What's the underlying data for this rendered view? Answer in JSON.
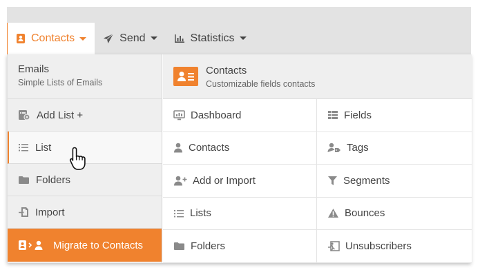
{
  "nav": {
    "items": [
      {
        "label": "Contacts",
        "icon": "contacts-book-icon",
        "active": true
      },
      {
        "label": "Send",
        "icon": "paper-plane-icon"
      },
      {
        "label": "Statistics",
        "icon": "bar-chart-icon"
      }
    ]
  },
  "left": {
    "title": "Emails",
    "subtitle": "Simple Lists of Emails",
    "items": [
      {
        "label": "Add List +",
        "icon": "add-list-icon"
      },
      {
        "label": "List",
        "icon": "list-icon"
      },
      {
        "label": "Folders",
        "icon": "folder-icon"
      },
      {
        "label": "Import",
        "icon": "import-icon"
      },
      {
        "label": "Migrate to Contacts",
        "icon": "migrate-icon"
      }
    ]
  },
  "right": {
    "title": "Contacts",
    "subtitle": "Customizable fields contacts",
    "items": [
      {
        "label": "Dashboard",
        "icon": "dashboard-icon"
      },
      {
        "label": "Fields",
        "icon": "fields-icon"
      },
      {
        "label": "Contacts",
        "icon": "user-icon"
      },
      {
        "label": "Tags",
        "icon": "tags-icon"
      },
      {
        "label": "Add or Import",
        "icon": "user-plus-icon"
      },
      {
        "label": "Segments",
        "icon": "filter-icon"
      },
      {
        "label": "Lists",
        "icon": "list-icon"
      },
      {
        "label": "Bounces",
        "icon": "warning-icon"
      },
      {
        "label": "Folders",
        "icon": "folder-icon"
      },
      {
        "label": "Unsubscribers",
        "icon": "exit-icon"
      }
    ]
  },
  "colors": {
    "accent": "#f0822e",
    "topbar": "#e3e3e3",
    "panel": "#efefef",
    "icon": "#8a8a8a"
  }
}
